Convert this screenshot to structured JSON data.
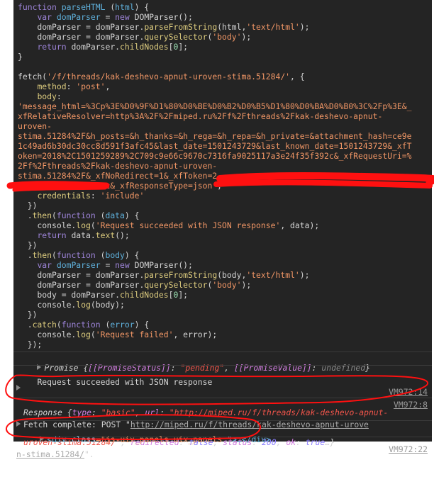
{
  "code_lines": [
    [
      [
        "kw",
        "function "
      ],
      [
        "var",
        "parseHTML "
      ],
      [
        "pl",
        "("
      ],
      [
        "var",
        "html"
      ],
      [
        "pl",
        ") {"
      ]
    ],
    [
      [
        "pl",
        "    "
      ],
      [
        "kw",
        "var "
      ],
      [
        "var",
        "domParser "
      ],
      [
        "pl",
        "= "
      ],
      [
        "kw",
        "new "
      ],
      [
        "pl",
        "DOMParser();"
      ]
    ],
    [
      [
        "pl",
        "    domParser = domParser."
      ],
      [
        "fn",
        "parseFromString"
      ],
      [
        "pl",
        "(html,"
      ],
      [
        "str",
        "'text/html'"
      ],
      [
        "pl",
        ");"
      ]
    ],
    [
      [
        "pl",
        "    domParser = domParser."
      ],
      [
        "fn",
        "querySelector"
      ],
      [
        "pl",
        "("
      ],
      [
        "str",
        "'body'"
      ],
      [
        "pl",
        ");"
      ]
    ],
    [
      [
        "pl",
        "    "
      ],
      [
        "kw",
        "return "
      ],
      [
        "pl",
        "domParser."
      ],
      [
        "fn",
        "childNodes"
      ],
      [
        "pl",
        "["
      ],
      [
        "num",
        "0"
      ],
      [
        "pl",
        "];"
      ]
    ],
    [
      [
        "pl",
        "}"
      ]
    ],
    [
      [
        "pl",
        " "
      ]
    ],
    [
      [
        "pl",
        "fetch("
      ],
      [
        "str",
        "'/f/threads/kak-deshevo-apnut-uroven-stima.51284/'"
      ],
      [
        "pl",
        ", {"
      ]
    ],
    [
      [
        "pl",
        "    "
      ],
      [
        "prop",
        "method"
      ],
      [
        "pl",
        ": "
      ],
      [
        "str",
        "'post'"
      ],
      [
        "pl",
        ","
      ]
    ],
    [
      [
        "pl",
        "    "
      ],
      [
        "prop",
        "body"
      ],
      [
        "pl",
        ":"
      ]
    ],
    [
      [
        "str",
        "'message_html=%3Cp%3E%D0%9F%D1%80%D0%BE%D0%B2%D0%B5%D1%80%D0%BA%D0%B0%3C%2Fp%3E&_"
      ]
    ],
    [
      [
        "str",
        "xfRelativeResolver=http%3A%2F%2Fmiped.ru%2Ff%2Fthreads%2Fkak-deshevo-apnut-"
      ]
    ],
    [
      [
        "str",
        "uroven-"
      ]
    ],
    [
      [
        "str",
        "stima.51284%2F&h_posts=&h_thanks=&h_rega=&h_repa=&h_private=&attachment_hash=ce9e"
      ]
    ],
    [
      [
        "str",
        "1c49ad6b30dc30cc8d591f3afc45&last_date=1501243729&last_known_date=1501243729&_xfT"
      ]
    ],
    [
      [
        "str",
        "oken=2018%2C1501259289%2C709c9e66c9670c7316fa9025117a3e24f35f392c&_xfRequestUri=%"
      ]
    ],
    [
      [
        "str",
        "2Ff%2Fthreads%2Fkak-deshevo-apnut-uroven-"
      ]
    ],
    [
      [
        "str",
        "stima.51284%2F&_xfNoRedirect=1&_xfToken=2"
      ]
    ],
    [
      [
        "str",
        "                  c&_xfResponseType=json'"
      ],
      [
        "pl",
        ","
      ]
    ],
    [
      [
        "pl",
        "    "
      ],
      [
        "prop",
        "credentials"
      ],
      [
        "pl",
        ": "
      ],
      [
        "str",
        "'include'"
      ]
    ],
    [
      [
        "pl",
        "  })"
      ]
    ],
    [
      [
        "pl",
        "  ."
      ],
      [
        "fn",
        "then"
      ],
      [
        "pl",
        "("
      ],
      [
        "kw",
        "function "
      ],
      [
        "pl",
        "("
      ],
      [
        "var",
        "data"
      ],
      [
        "pl",
        ") {"
      ]
    ],
    [
      [
        "pl",
        "    console."
      ],
      [
        "fn",
        "log"
      ],
      [
        "pl",
        "("
      ],
      [
        "str",
        "'Request succeeded with JSON response'"
      ],
      [
        "pl",
        ", data);"
      ]
    ],
    [
      [
        "pl",
        "    "
      ],
      [
        "kw",
        "return "
      ],
      [
        "pl",
        "data."
      ],
      [
        "fn",
        "text"
      ],
      [
        "pl",
        "();"
      ]
    ],
    [
      [
        "pl",
        "  })"
      ]
    ],
    [
      [
        "pl",
        "  ."
      ],
      [
        "fn",
        "then"
      ],
      [
        "pl",
        "("
      ],
      [
        "kw",
        "function "
      ],
      [
        "pl",
        "("
      ],
      [
        "var",
        "body"
      ],
      [
        "pl",
        ") {"
      ]
    ],
    [
      [
        "pl",
        "    "
      ],
      [
        "kw",
        "var "
      ],
      [
        "var",
        "domParser "
      ],
      [
        "pl",
        "= "
      ],
      [
        "kw",
        "new "
      ],
      [
        "pl",
        "DOMParser();"
      ]
    ],
    [
      [
        "pl",
        "    domParser = domParser."
      ],
      [
        "fn",
        "parseFromString"
      ],
      [
        "pl",
        "(body,"
      ],
      [
        "str",
        "'text/html'"
      ],
      [
        "pl",
        ");"
      ]
    ],
    [
      [
        "pl",
        "    domParser = domParser."
      ],
      [
        "fn",
        "querySelector"
      ],
      [
        "pl",
        "("
      ],
      [
        "str",
        "'body'"
      ],
      [
        "pl",
        ");"
      ]
    ],
    [
      [
        "pl",
        "    body = domParser."
      ],
      [
        "fn",
        "childNodes"
      ],
      [
        "pl",
        "["
      ],
      [
        "num",
        "0"
      ],
      [
        "pl",
        "];"
      ]
    ],
    [
      [
        "pl",
        "    console."
      ],
      [
        "fn",
        "log"
      ],
      [
        "pl",
        "(body);"
      ]
    ],
    [
      [
        "pl",
        "  })"
      ]
    ],
    [
      [
        "pl",
        "  ."
      ],
      [
        "fn",
        "catch"
      ],
      [
        "pl",
        "("
      ],
      [
        "kw",
        "function "
      ],
      [
        "pl",
        "("
      ],
      [
        "var",
        "error"
      ],
      [
        "pl",
        ") {"
      ]
    ],
    [
      [
        "pl",
        "    console."
      ],
      [
        "fn",
        "log"
      ],
      [
        "pl",
        "("
      ],
      [
        "str",
        "'Request failed'"
      ],
      [
        "pl",
        ", error);"
      ]
    ],
    [
      [
        "pl",
        "  });"
      ]
    ]
  ],
  "promise": {
    "label": "Promise ",
    "open": "{",
    "k1": "[[PromiseStatus]]",
    "v1": "\"pending\"",
    "k2": "[[PromiseValue]]",
    "v2": "undefined",
    "close": "}"
  },
  "log1": {
    "text": "Request succeeded with JSON response",
    "source": "VM972:14"
  },
  "response": {
    "label": "Response ",
    "type_key": "type",
    "type_val": "\"basic\"",
    "url_key": "url",
    "url_val1": "\"http://miped.ru/f/threads/kak-deshevo-apnut-",
    "url_val2": "uroven-stima.51284/\"",
    "redir_key": "redirected",
    "redir_val": "false",
    "status_key": "status",
    "status_val": "200",
    "ok_key": "ok",
    "ok_val": "true"
  },
  "fetch_log": {
    "prefix": "Fetch complete: POST \"",
    "url1": "http://miped.ru/f/threads/kak-deshevo-apnut-urove",
    "url2": "n-stima.51284/",
    "suffix": "\".",
    "source": "VM972:8"
  },
  "div_log": {
    "open": "<div ",
    "attr": "class",
    "eq": "=\"",
    "val": "js-uix_panels uix_panels ",
    "close": "\">…</div>",
    "source": "VM972:22"
  },
  "colors": {
    "background": "#242424",
    "annotation": "#ff0000"
  }
}
